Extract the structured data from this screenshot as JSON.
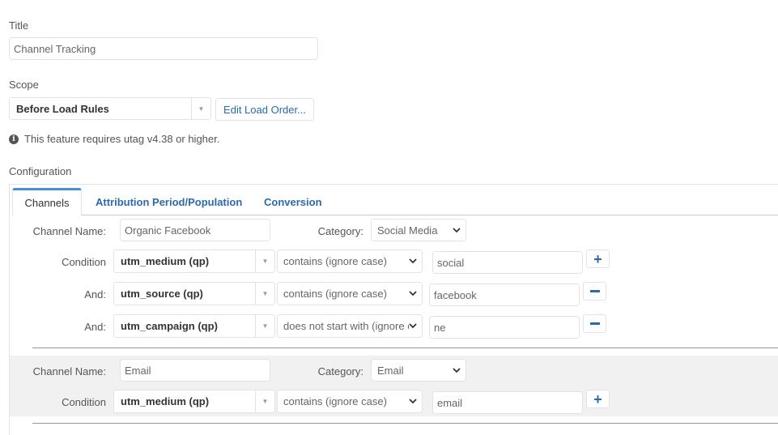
{
  "title": {
    "label": "Title",
    "value": "Channel Tracking"
  },
  "scope": {
    "label": "Scope",
    "selected": "Before Load Rules",
    "edit_button": "Edit Load Order..."
  },
  "notice": {
    "icon": "info-icon",
    "text": "This feature requires utag v4.38 or higher."
  },
  "configuration": {
    "label": "Configuration",
    "tabs": [
      {
        "label": "Channels",
        "active": true
      },
      {
        "label": "Attribution Period/Population",
        "active": false
      },
      {
        "label": "Conversion",
        "active": false
      }
    ],
    "channels": [
      {
        "name_label": "Channel Name:",
        "name": "Organic Facebook",
        "category_label": "Category:",
        "category": "Social Media",
        "conditions": [
          {
            "label": "Condition",
            "variable": "utm_medium (qp)",
            "operator": "contains (ignore case)",
            "value": "social",
            "action": "add"
          },
          {
            "label": "And:",
            "variable": "utm_source (qp)",
            "operator": "contains (ignore case)",
            "value": "facebook",
            "action": "remove"
          },
          {
            "label": "And:",
            "variable": "utm_campaign (qp)",
            "operator": "does not start with (ignore case)",
            "value": "ne",
            "action": "remove"
          }
        ]
      },
      {
        "name_label": "Channel Name:",
        "name": "Email",
        "category_label": "Category:",
        "category": "Email",
        "conditions": [
          {
            "label": "Condition",
            "variable": "utm_medium (qp)",
            "operator": "contains (ignore case)",
            "value": "email",
            "action": "add"
          }
        ]
      }
    ]
  },
  "colors": {
    "accent": "#2a6aad",
    "tab_top": "#4a90d9",
    "border": "#dfe3ea",
    "row_alt_bg": "#f1f1f1"
  }
}
